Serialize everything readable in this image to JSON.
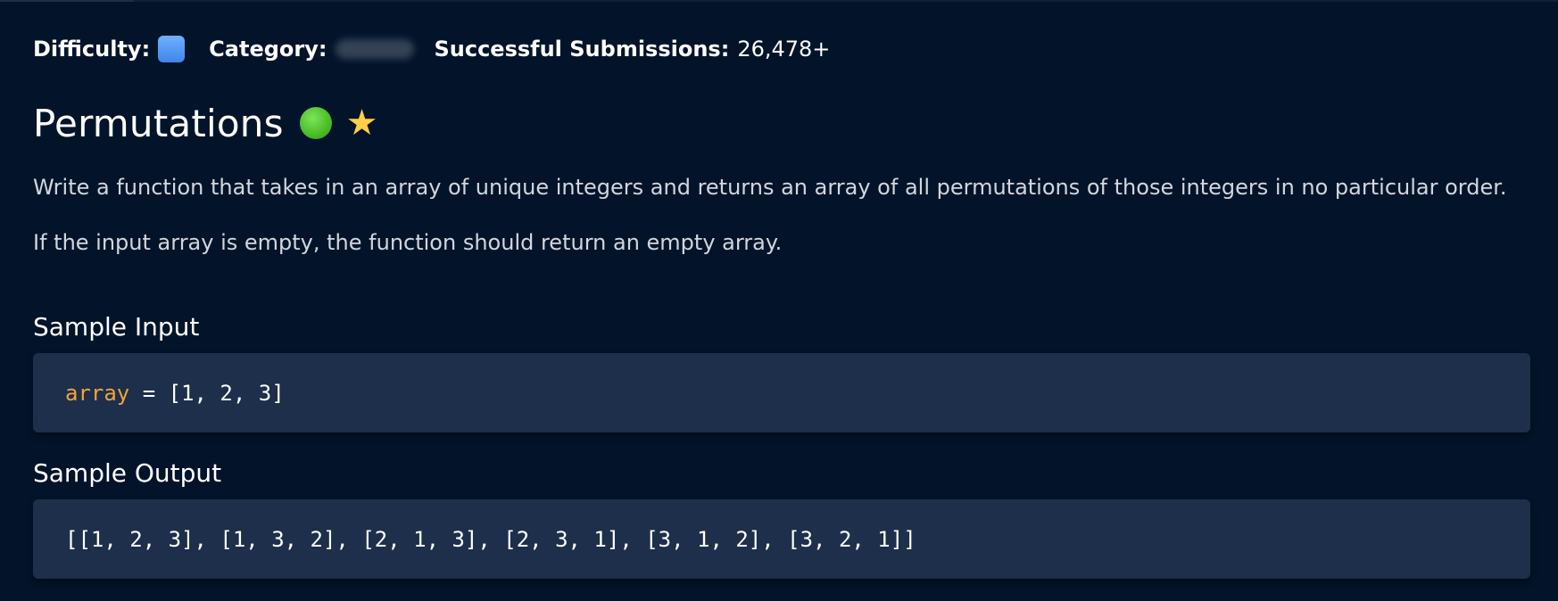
{
  "meta": {
    "difficulty_label": "Difficulty:",
    "difficulty_color": "#4a90e2",
    "category_label": "Category:",
    "submissions_label": "Successful Submissions:",
    "submissions_value": "26,478+"
  },
  "problem": {
    "title": "Permutations",
    "status_icon": "green-circle-icon",
    "star_icon": "star-icon",
    "description": [
      "Write a function that takes in an array of unique integers and returns an array of all permutations of those integers in no particular order.",
      "If the input array is empty, the function should return an empty array."
    ]
  },
  "sample_input": {
    "heading": "Sample Input",
    "variable": "array",
    "rest": " = [1, 2, 3]"
  },
  "sample_output": {
    "heading": "Sample Output",
    "code": "[[1, 2, 3], [1, 3, 2], [2, 1, 3], [2, 3, 1], [3, 1, 2], [3, 2, 1]]"
  },
  "colors": {
    "background": "#03142a",
    "code_background": "#1d2f4a",
    "code_variable": "#f2a33a",
    "status_green": "#4cc02a",
    "star_yellow": "#ffce4a"
  }
}
